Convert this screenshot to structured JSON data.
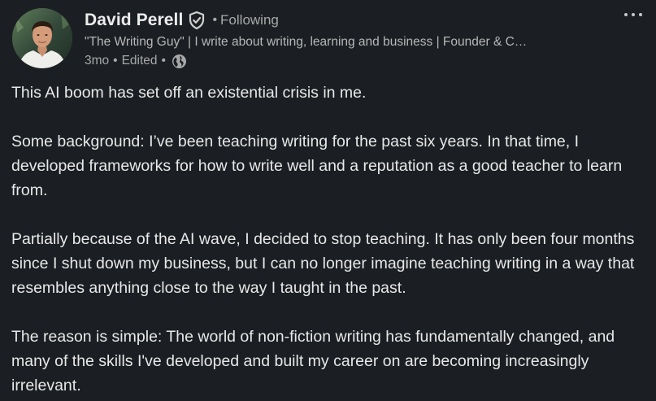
{
  "post": {
    "author": {
      "name": "David Perell",
      "connection_status": "Following",
      "headline": "\"The Writing Guy\" | I write about writing, learning and business | Founder & C…",
      "time": "3mo",
      "edited_label": "Edited"
    },
    "icons": {
      "verified": "shield-check-icon",
      "visibility": "globe-icon",
      "more": "more-options-icon"
    },
    "paragraphs": [
      "This AI boom has set off an existential crisis in me.",
      "Some background: I’ve been teaching writing for the past six years. In that time, I developed frameworks for how to write well and a reputation as a good teacher to learn from.",
      "Partially because of the AI wave, I decided to stop teaching. It has only been four months since I shut down my business, but I can no longer imagine teaching writing in a way that resembles anything close to the way I taught in the past.",
      "The reason is simple: The world of non-fiction writing has fundamentally changed, and many of the skills I've developed and built my career on are becoming increasingly irrelevant."
    ]
  },
  "colors": {
    "background": "#1b1f23",
    "primary_text": "#e8e8e8",
    "secondary_text": "#a8a8a8"
  }
}
